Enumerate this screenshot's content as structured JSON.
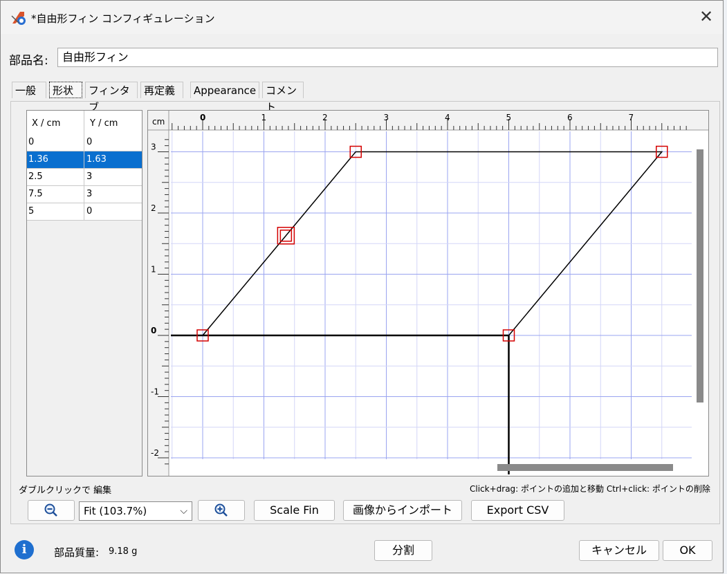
{
  "window": {
    "title": "*自由形フィン コンフィギュレーション"
  },
  "part_name": {
    "label": "部品名:",
    "value": "自由形フィン"
  },
  "tabs": [
    {
      "label": "一般",
      "active": false
    },
    {
      "label": "形状",
      "active": true
    },
    {
      "label": "フィンタブ",
      "active": false
    },
    {
      "label": "再定義",
      "active": false
    },
    {
      "label": "Appearance",
      "active": false
    },
    {
      "label": "コメント",
      "active": false
    }
  ],
  "points_table": {
    "headers": [
      "X / cm",
      "Y / cm"
    ],
    "rows": [
      {
        "x": "0",
        "y": "0",
        "selected": false
      },
      {
        "x": "1.36",
        "y": "1.63",
        "selected": true
      },
      {
        "x": "2.5",
        "y": "3",
        "selected": false
      },
      {
        "x": "7.5",
        "y": "3",
        "selected": false
      },
      {
        "x": "5",
        "y": "0",
        "selected": false
      }
    ]
  },
  "canvas": {
    "unit_label": "cm",
    "x_ticks": [
      "0",
      "1",
      "2",
      "3",
      "4",
      "5",
      "6",
      "7"
    ],
    "y_ticks": [
      "3",
      "2",
      "1",
      "0",
      "-1",
      "-2"
    ],
    "fin_points": [
      [
        0,
        0
      ],
      [
        1.36,
        1.63
      ],
      [
        2.5,
        3
      ],
      [
        7.5,
        3
      ],
      [
        5,
        0
      ]
    ],
    "selected_index": 1,
    "x_range": [
      -0.5,
      8
    ],
    "y_range": [
      -2.05,
      3.25
    ]
  },
  "hints": {
    "left": "ダブルクリックで 編集",
    "right": "Click+drag: ポイントの追加と移動   Ctrl+click: ポイントの削除"
  },
  "toolbar": {
    "zoom_out_icon": "zoom-out-icon",
    "zoom_value": "Fit (103.7%)",
    "zoom_in_icon": "zoom-in-icon",
    "scale_fin": "Scale Fin",
    "import_image": "画像からインポート",
    "export_csv": "Export CSV"
  },
  "footer": {
    "mass_label": "部品質量:",
    "mass_value": "9.18 g",
    "split": "分割",
    "cancel": "キャンセル",
    "ok": "OK"
  },
  "colors": {
    "accent": "#0a6fcf",
    "grid": "#c8c8f0",
    "point": "#d40000"
  }
}
